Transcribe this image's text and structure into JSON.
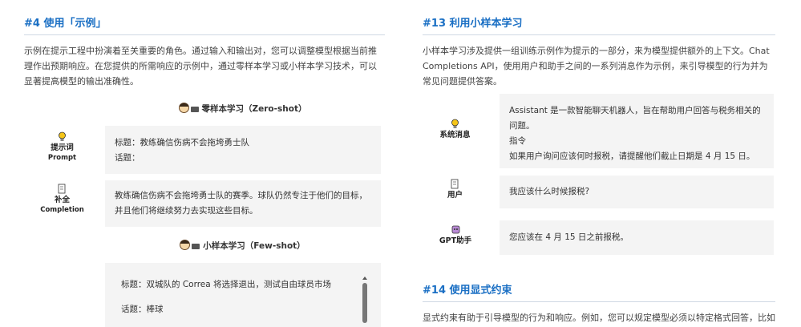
{
  "left": {
    "section_title": "#4  使用「示例」",
    "intro": "示例在提示工程中扮演着至关重要的角色。通过输入和输出对，您可以调整模型根据当前推理作出预期响应。在您提供的所需响应的示例中，通过零样本学习或小样本学习技术，可以显著提高模型的输出准确性。",
    "zero_shot_title": "零样本学习（Zero-shot）",
    "prompt_label": "提示词",
    "prompt_label_en": "Prompt",
    "prompt_line1": "标题：教练确信伤病不会拖垮勇士队",
    "prompt_line2": "话题：",
    "completion_label": "补全",
    "completion_label_en": "Completion",
    "completion_text": "教练确信伤病不会拖垮勇士队的赛季。球队仍然专注于他们的目标，并且他们将继续努力去实现这些目标。",
    "few_shot_title": "小样本学习（Few-shot）",
    "few_line1": "标题：双城队的 Correa 将选择退出，测试自由球员市场",
    "few_line2": "话题：棒球"
  },
  "right": {
    "section13_title": "#13  利用小样本学习",
    "intro": "小样本学习涉及提供一组训练示例作为提示的一部分，来为模型提供额外的上下文。Chat Completions API，使用用户和助手之间的一系列消息作为示例，来引导模型的行为并为常见问题提供答案。",
    "system_label": "系统消息",
    "system_line1": "Assistant 是一款智能聊天机器人，旨在帮助用户回答与税务相关的问题。",
    "system_line2": "指令",
    "system_line3": "如果用户询问应该何时报税，请提醒他们截止日期是 4 月 15 日。",
    "user_label": "用户",
    "user_text": "我应该什么时候报税?",
    "gpt_label": "GPT助手",
    "gpt_text": "您应该在 4 月 15 日之前报税。",
    "section14_title": "#14  使用显式约束",
    "section14_intro": "显式约束有助于引导模型的行为和响应。例如，您可以规定模型必须以特定格式回答，比如"
  },
  "colors": {
    "accent": "#1a6fc4",
    "box": "#f4f4f4"
  }
}
